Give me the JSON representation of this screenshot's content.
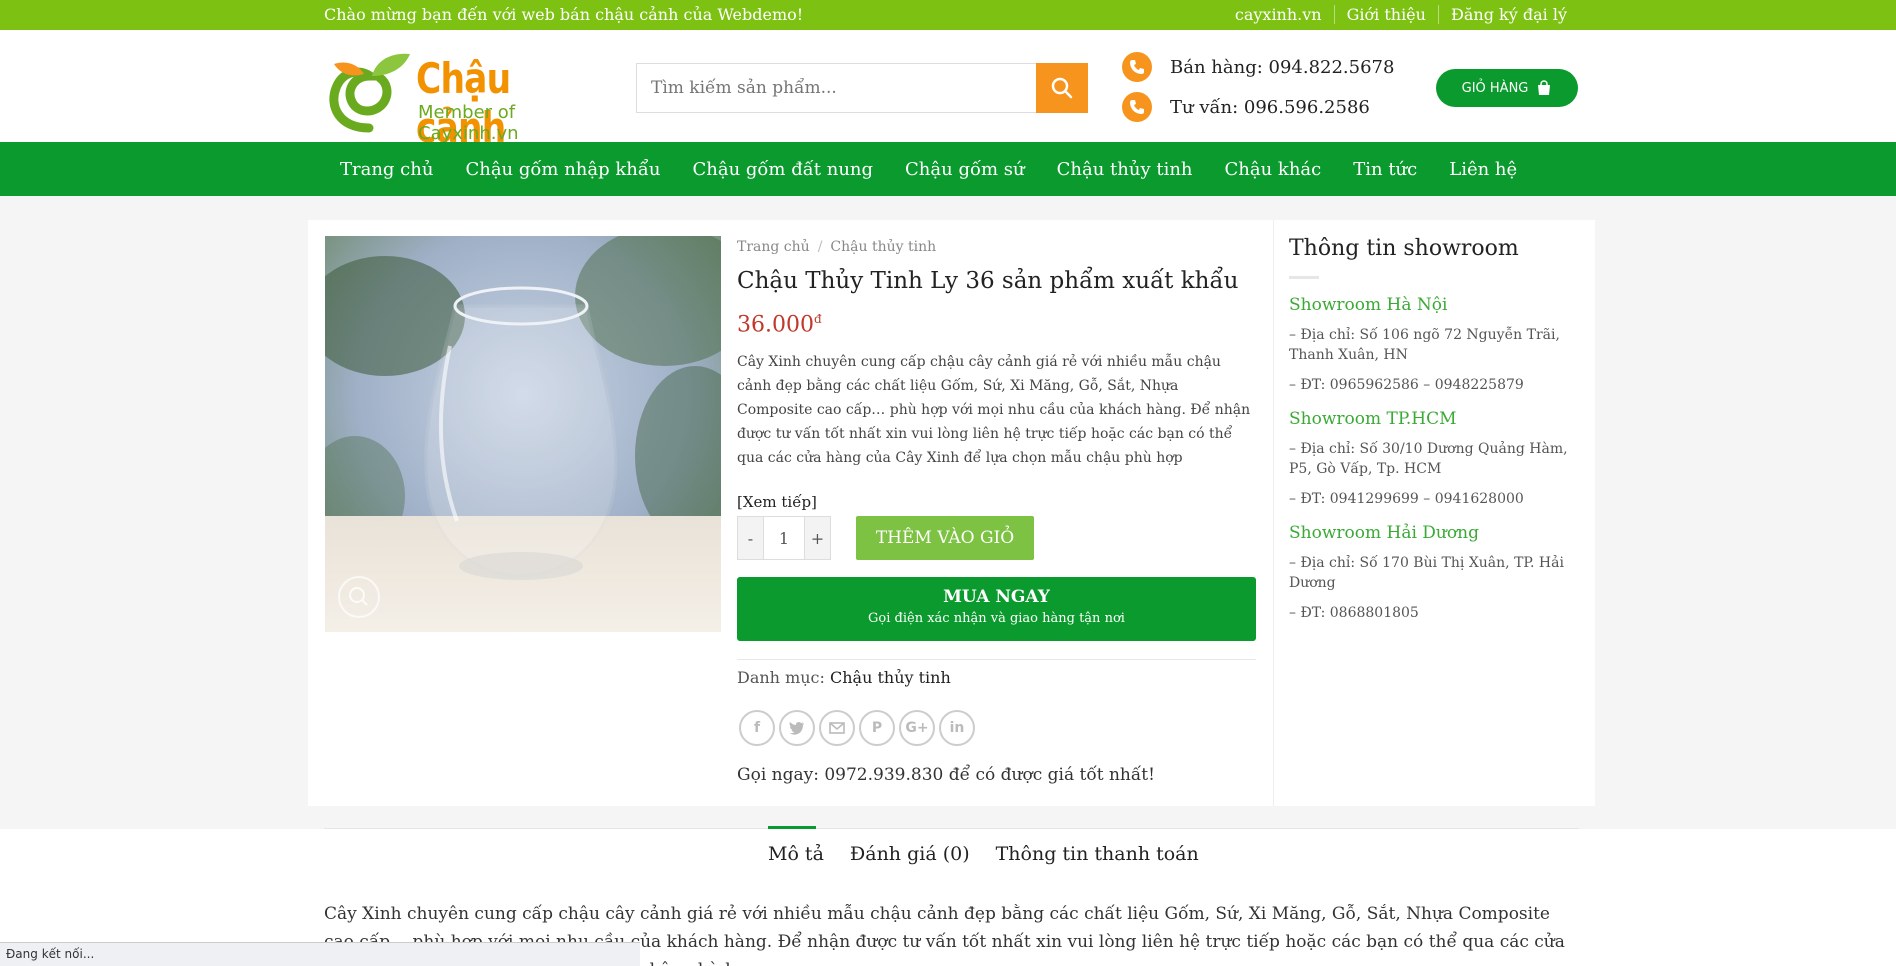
{
  "topbar": {
    "welcome": "Chào mừng bạn đến với web bán chậu cảnh của Webdemo!",
    "links": [
      "cayxinh.vn",
      "Giới thiệu",
      "Đăng ký đại lý"
    ]
  },
  "header": {
    "logo_brand": "Chậu cảnh",
    "logo_member": "Member of Cayxinh.vn",
    "search_placeholder": "Tìm kiếm sản phẩm...",
    "sales": "Bán hàng: 094.822.5678",
    "consult": "Tư vấn: 096.596.2586",
    "cart_label": "GIỎ HÀNG"
  },
  "nav": [
    "Trang chủ",
    "Chậu gốm nhập khẩu",
    "Chậu gốm đất nung",
    "Chậu gốm sứ",
    "Chậu thủy tinh",
    "Chậu khác",
    "Tin tức",
    "Liên hệ"
  ],
  "product": {
    "breadcrumb": [
      "Trang chủ",
      "Chậu thủy tinh"
    ],
    "title": "Chậu Thủy Tinh Ly 36 sản phẩm xuất khẩu",
    "price": "36.000",
    "currency": "đ",
    "description": "Cây Xinh chuyên cung cấp chậu cây cảnh giá rẻ với nhiều mẫu chậu cảnh đẹp bằng các chất liệu Gốm, Sứ, Xi Măng, Gỗ, Sắt, Nhựa Composite cao cấp… phù hợp với mọi nhu cầu của khách hàng. Để nhận được tư vấn tốt nhất xin vui lòng liên hệ trực tiếp hoặc các bạn có thể qua các cửa hàng của Cây Xinh để lựa chọn mẫu chậu phù hợp",
    "read_more": "[Xem tiếp]",
    "qty_minus": "-",
    "qty_value": "1",
    "qty_plus": "+",
    "add_to_cart": "THÊM VÀO GIỎ",
    "buy_now": "MUA NGAY",
    "buy_now_sub": "Gọi điện xác nhận và giao hàng tận nơi",
    "category_label": "Danh mục:",
    "category_value": "Chậu thủy tinh",
    "call_now": "Gọi ngay: 0972.939.830 để có được giá tốt nhất!"
  },
  "sidebar": {
    "title": "Thông tin showroom",
    "showrooms": [
      {
        "name": "Showroom Hà Nội",
        "address": "– Địa chỉ: Số 106 ngõ 72 Nguyễn Trãi, Thanh Xuân, HN",
        "phone": "– ĐT: 0965962586 – 0948225879"
      },
      {
        "name": "Showroom TP.HCM",
        "address": "– Địa chỉ: Số 30/10 Dương Quảng Hàm, P5, Gò Vấp, Tp. HCM",
        "phone": "– ĐT: 0941299699 – 0941628000"
      },
      {
        "name": "Showroom Hải Dương",
        "address": "– Địa chỉ: Số 170 Bùi Thị Xuân, TP. Hải Dương",
        "phone": "– ĐT: 0868801805"
      }
    ]
  },
  "tabs": [
    "Mô tả",
    "Đánh giá (0)",
    "Thông tin thanh toán"
  ],
  "tab_body": "Cây Xinh chuyên cung cấp chậu cây cảnh giá rẻ với nhiều mẫu chậu cảnh đẹp bằng các chất liệu Gốm, Sứ, Xi Măng, Gỗ, Sắt, Nhựa Composite cao cấp… phù hợp với mọi nhu cầu của khách hàng. Để nhận được tư vấn tốt nhất xin vui lòng liên hệ trực tiếp hoặc các bạn có thể qua các cửa hàng của Cây Xinh để lựa chọn mẫu chậu phù hợp",
  "status_bar": "Đang kết nối...",
  "colors": {
    "topbar": "#7dc213",
    "nav": "#0b9a2d",
    "accent": "#f7941d",
    "price": "#c0392b"
  },
  "icons": [
    "search-icon",
    "phone-icon",
    "cart-bag-icon",
    "zoom-icon",
    "facebook-icon",
    "twitter-icon",
    "email-icon",
    "pinterest-icon",
    "google-plus-icon",
    "linkedin-icon"
  ]
}
